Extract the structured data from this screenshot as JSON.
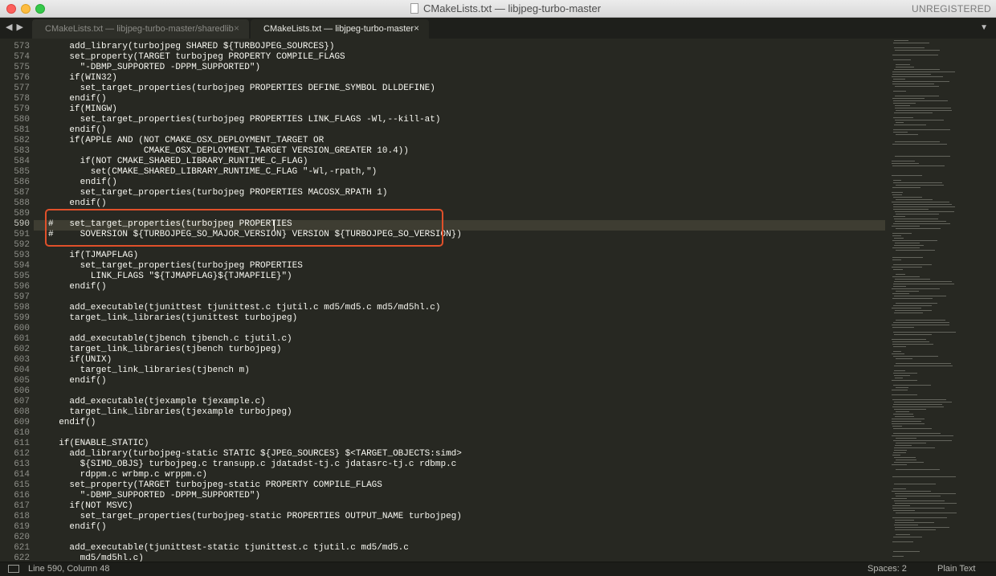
{
  "window": {
    "title": "CMakeLists.txt — libjpeg-turbo-master",
    "badge": "UNREGISTERED"
  },
  "tabs": [
    {
      "label": "CMakeLists.txt — libjpeg-turbo-master/sharedlib",
      "active": false
    },
    {
      "label": "CMakeLists.txt — libjpeg-turbo-master",
      "active": true
    }
  ],
  "nav": {
    "back": "◀",
    "forward": "▶"
  },
  "editor": {
    "current_line": 590,
    "lines": [
      {
        "n": "573",
        "text": "    add_library(turbojpeg SHARED ${TURBOJPEG_SOURCES})"
      },
      {
        "n": "574",
        "text": "    set_property(TARGET turbojpeg PROPERTY COMPILE_FLAGS"
      },
      {
        "n": "575",
        "text": "      \"-DBMP_SUPPORTED -DPPM_SUPPORTED\")"
      },
      {
        "n": "576",
        "text": "    if(WIN32)"
      },
      {
        "n": "577",
        "text": "      set_target_properties(turbojpeg PROPERTIES DEFINE_SYMBOL DLLDEFINE)"
      },
      {
        "n": "578",
        "text": "    endif()"
      },
      {
        "n": "579",
        "text": "    if(MINGW)"
      },
      {
        "n": "580",
        "text": "      set_target_properties(turbojpeg PROPERTIES LINK_FLAGS -Wl,--kill-at)"
      },
      {
        "n": "581",
        "text": "    endif()"
      },
      {
        "n": "582",
        "text": "    if(APPLE AND (NOT CMAKE_OSX_DEPLOYMENT_TARGET OR"
      },
      {
        "n": "583",
        "text": "                  CMAKE_OSX_DEPLOYMENT_TARGET VERSION_GREATER 10.4))"
      },
      {
        "n": "584",
        "text": "      if(NOT CMAKE_SHARED_LIBRARY_RUNTIME_C_FLAG)"
      },
      {
        "n": "585",
        "text": "        set(CMAKE_SHARED_LIBRARY_RUNTIME_C_FLAG \"-Wl,-rpath,\")"
      },
      {
        "n": "586",
        "text": "      endif()"
      },
      {
        "n": "587",
        "text": "      set_target_properties(turbojpeg PROPERTIES MACOSX_RPATH 1)"
      },
      {
        "n": "588",
        "text": "    endif()"
      },
      {
        "n": "589",
        "text": ""
      },
      {
        "n": "590",
        "text": "#   set_target_properties(turbojpeg PROPERTIES"
      },
      {
        "n": "591",
        "text": "#     SOVERSION ${TURBOJPEG_SO_MAJOR_VERSION} VERSION ${TURBOJPEG_SO_VERSION})"
      },
      {
        "n": "592",
        "text": ""
      },
      {
        "n": "593",
        "text": "    if(TJMAPFLAG)"
      },
      {
        "n": "594",
        "text": "      set_target_properties(turbojpeg PROPERTIES"
      },
      {
        "n": "595",
        "text": "        LINK_FLAGS \"${TJMAPFLAG}${TJMAPFILE}\")"
      },
      {
        "n": "596",
        "text": "    endif()"
      },
      {
        "n": "597",
        "text": ""
      },
      {
        "n": "598",
        "text": "    add_executable(tjunittest tjunittest.c tjutil.c md5/md5.c md5/md5hl.c)"
      },
      {
        "n": "599",
        "text": "    target_link_libraries(tjunittest turbojpeg)"
      },
      {
        "n": "600",
        "text": ""
      },
      {
        "n": "601",
        "text": "    add_executable(tjbench tjbench.c tjutil.c)"
      },
      {
        "n": "602",
        "text": "    target_link_libraries(tjbench turbojpeg)"
      },
      {
        "n": "603",
        "text": "    if(UNIX)"
      },
      {
        "n": "604",
        "text": "      target_link_libraries(tjbench m)"
      },
      {
        "n": "605",
        "text": "    endif()"
      },
      {
        "n": "606",
        "text": ""
      },
      {
        "n": "607",
        "text": "    add_executable(tjexample tjexample.c)"
      },
      {
        "n": "608",
        "text": "    target_link_libraries(tjexample turbojpeg)"
      },
      {
        "n": "609",
        "text": "  endif()"
      },
      {
        "n": "610",
        "text": ""
      },
      {
        "n": "611",
        "text": "  if(ENABLE_STATIC)"
      },
      {
        "n": "612",
        "text": "    add_library(turbojpeg-static STATIC ${JPEG_SOURCES} $<TARGET_OBJECTS:simd>"
      },
      {
        "n": "613",
        "text": "      ${SIMD_OBJS} turbojpeg.c transupp.c jdatadst-tj.c jdatasrc-tj.c rdbmp.c"
      },
      {
        "n": "614",
        "text": "      rdppm.c wrbmp.c wrppm.c)"
      },
      {
        "n": "615",
        "text": "    set_property(TARGET turbojpeg-static PROPERTY COMPILE_FLAGS"
      },
      {
        "n": "616",
        "text": "      \"-DBMP_SUPPORTED -DPPM_SUPPORTED\")"
      },
      {
        "n": "617",
        "text": "    if(NOT MSVC)"
      },
      {
        "n": "618",
        "text": "      set_target_properties(turbojpeg-static PROPERTIES OUTPUT_NAME turbojpeg)"
      },
      {
        "n": "619",
        "text": "    endif()"
      },
      {
        "n": "620",
        "text": ""
      },
      {
        "n": "621",
        "text": "    add_executable(tjunittest-static tjunittest.c tjutil.c md5/md5.c"
      },
      {
        "n": "622",
        "text": "      md5/md5hl.c)"
      }
    ]
  },
  "status": {
    "position": "Line 590, Column 48",
    "spaces": "Spaces: 2",
    "syntax": "Plain Text"
  },
  "colors": {
    "background": "#272822",
    "highlight_box": "#e0502a",
    "current_line": "#3e3d32"
  },
  "icons": {
    "tab_close": "×",
    "tab_dropdown": "▼"
  }
}
